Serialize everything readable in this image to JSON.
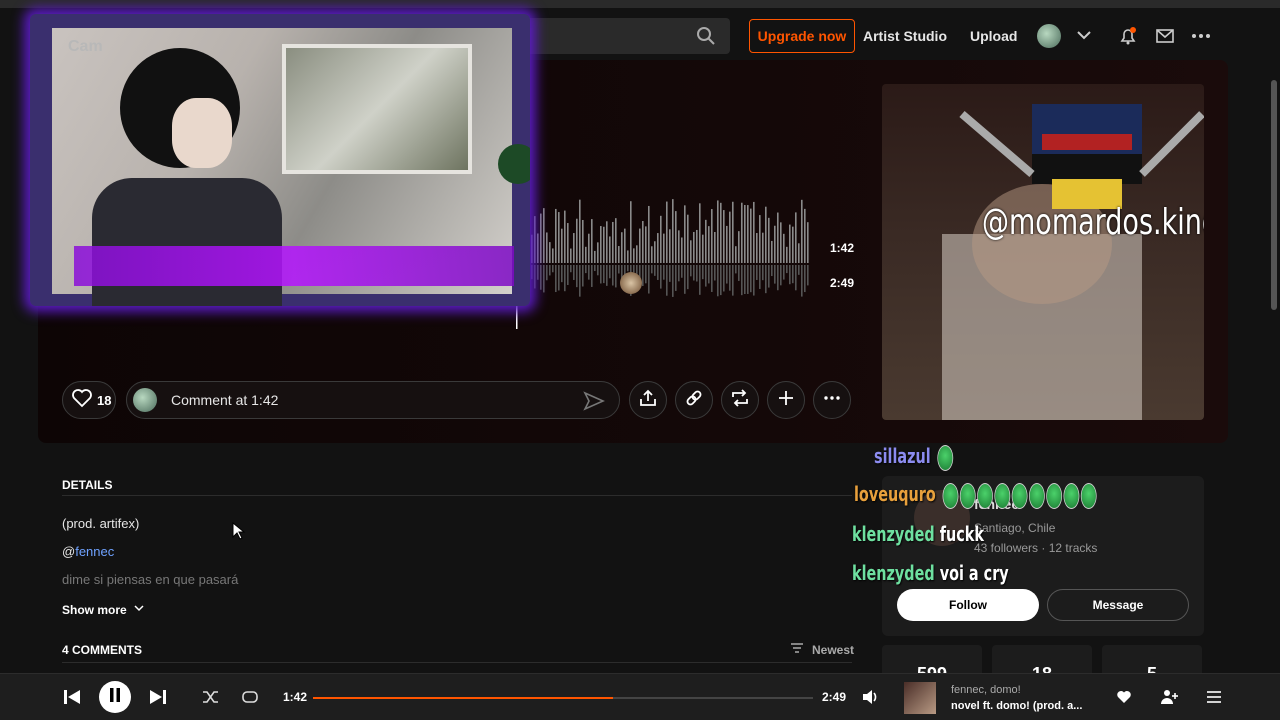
{
  "nav": {
    "upgrade_label": "Upgrade now",
    "artist_studio_label": "Artist Studio",
    "upload_label": "Upload"
  },
  "accent_color": "#ff5500",
  "player_hero": {
    "current_time": "1:42",
    "duration": "2:49"
  },
  "artwork": {
    "overlay_text": "@momardos.kinoto"
  },
  "webcam": {
    "label": "Cam"
  },
  "actions": {
    "like_count": "18",
    "comment_placeholder": "Comment at 1:42"
  },
  "details": {
    "title": "DETAILS",
    "line1": "(prod. artifex)",
    "mention_at": "@",
    "mention_name": "fennec",
    "line3": "dime si piensas en que pasará",
    "show_more": "Show more"
  },
  "comments": {
    "title": "4 COMMENTS",
    "sort_label": "Newest"
  },
  "artist": {
    "name": "fennec",
    "location": "Santiago, Chile",
    "stats_line": "43 followers · 12 tracks",
    "follow_label": "Follow",
    "message_label": "Message",
    "stat1": "599",
    "stat2": "18",
    "stat3": "5"
  },
  "chat": [
    {
      "user": "sillazul",
      "message": "",
      "color": "#8c8cf0"
    },
    {
      "user": "loveuquro",
      "message": "",
      "color": "#e8a03c"
    },
    {
      "user": "klenzyded",
      "message": "fuckk",
      "color": "#6ee0a0"
    },
    {
      "user": "klenzyded",
      "message": "voi a cry",
      "color": "#6ee0a0"
    }
  ],
  "bottom_player": {
    "current_time": "1:42",
    "duration": "2:49",
    "progress": 0.6,
    "artist": "fennec, domo!",
    "title": "novel ft. domo! (prod. a..."
  }
}
